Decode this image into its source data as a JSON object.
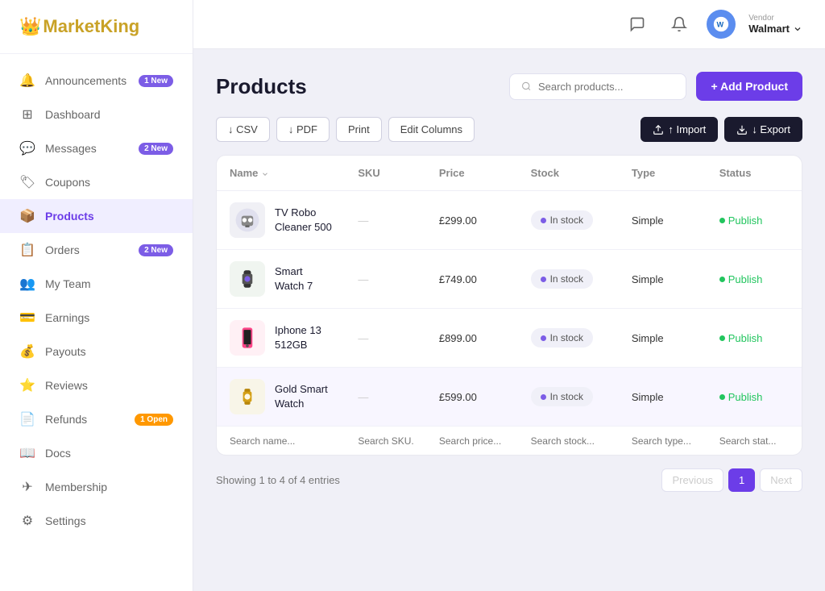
{
  "brand": {
    "logo_crown": "👑",
    "name_start": "Market",
    "name_end": "King"
  },
  "sidebar": {
    "items": [
      {
        "id": "announcements",
        "label": "Announcements",
        "icon": "🔔",
        "badge": "1 New",
        "badge_type": "new"
      },
      {
        "id": "dashboard",
        "label": "Dashboard",
        "icon": "⊞",
        "badge": null
      },
      {
        "id": "messages",
        "label": "Messages",
        "icon": "💬",
        "badge": "2 New",
        "badge_type": "new"
      },
      {
        "id": "coupons",
        "label": "Coupons",
        "icon": "🏷",
        "badge": null
      },
      {
        "id": "products",
        "label": "Products",
        "icon": "📦",
        "badge": null,
        "active": true
      },
      {
        "id": "orders",
        "label": "Orders",
        "icon": "📋",
        "badge": "2 New",
        "badge_type": "new"
      },
      {
        "id": "myteam",
        "label": "My Team",
        "icon": "👥",
        "badge": null
      },
      {
        "id": "earnings",
        "label": "Earnings",
        "icon": "💳",
        "badge": null
      },
      {
        "id": "payouts",
        "label": "Payouts",
        "icon": "💰",
        "badge": null
      },
      {
        "id": "reviews",
        "label": "Reviews",
        "icon": "⭐",
        "badge": null
      },
      {
        "id": "refunds",
        "label": "Refunds",
        "icon": "📄",
        "badge": "1 Open",
        "badge_type": "open"
      },
      {
        "id": "docs",
        "label": "Docs",
        "icon": "📖",
        "badge": null
      },
      {
        "id": "membership",
        "label": "Membership",
        "icon": "✈",
        "badge": null
      },
      {
        "id": "settings",
        "label": "Settings",
        "icon": "⚙",
        "badge": null
      }
    ]
  },
  "topbar": {
    "chat_icon": "💬",
    "bell_icon": "🔔",
    "vendor_label": "Vendor",
    "vendor_name": "Walmart",
    "vendor_emoji": "🔵"
  },
  "page": {
    "title": "Products",
    "search_placeholder": "Search products...",
    "add_button": "+ Add Product"
  },
  "toolbar": {
    "csv_label": "↓ CSV",
    "pdf_label": "↓ PDF",
    "print_label": "Print",
    "edit_columns_label": "Edit Columns",
    "import_label": "↑ Import",
    "export_label": "↓ Export"
  },
  "table": {
    "columns": [
      "Name",
      "SKU",
      "Price",
      "Stock",
      "Type",
      "Status"
    ],
    "rows": [
      {
        "id": 1,
        "name": "TV Robo Cleaner 500",
        "sku": "—",
        "price": "£299.00",
        "stock": "In stock",
        "type": "Simple",
        "status": "Publish",
        "highlighted": false,
        "thumb_color": "#f0f0f5",
        "thumb_type": "robot"
      },
      {
        "id": 2,
        "name": "Smart Watch 7",
        "sku": "—",
        "price": "£749.00",
        "stock": "In stock",
        "type": "Simple",
        "status": "Publish",
        "highlighted": false,
        "thumb_color": "#f0f5f0",
        "thumb_type": "watch"
      },
      {
        "id": 3,
        "name": "Iphone 13 512GB",
        "sku": "—",
        "price": "£899.00",
        "stock": "In stock",
        "type": "Simple",
        "status": "Publish",
        "highlighted": false,
        "thumb_color": "#fff0f5",
        "thumb_type": "phone"
      },
      {
        "id": 4,
        "name": "Gold Smart Watch",
        "sku": "—",
        "price": "£599.00",
        "stock": "In stock",
        "type": "Simple",
        "status": "Publish",
        "highlighted": true,
        "thumb_color": "#f8f5e8",
        "thumb_type": "goldwatch"
      }
    ],
    "search_placeholders": {
      "name": "Search name...",
      "sku": "Search SKU...",
      "price": "Search price...",
      "stock": "Search stock...",
      "type": "Search type...",
      "status": "Search stat..."
    }
  },
  "pagination": {
    "info": "Showing 1 to 4 of 4 entries",
    "prev_label": "Previous",
    "next_label": "Next",
    "current_page": 1,
    "pages": [
      1
    ]
  }
}
